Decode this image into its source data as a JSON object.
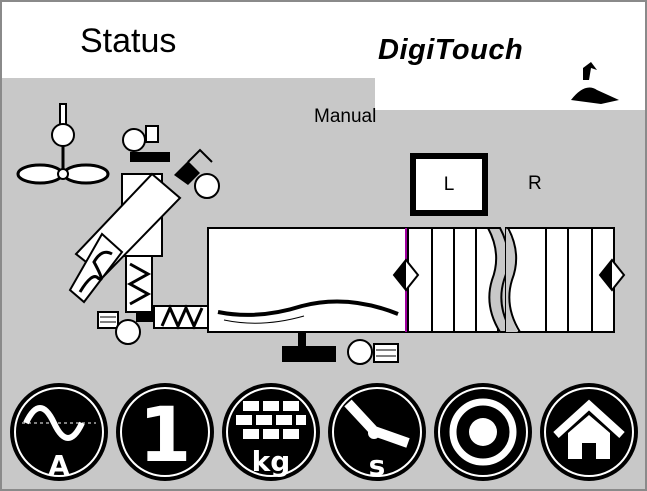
{
  "header": {
    "title": "Status",
    "logo_text": "DigiTouch"
  },
  "process": {
    "mode": "Manual",
    "side_selected": "L",
    "side_other": "R"
  },
  "buttons": [
    {
      "name": "analysis",
      "icon": "sine-wave-a-icon",
      "label": "A"
    },
    {
      "name": "program",
      "icon": "number-one-icon",
      "label": "1"
    },
    {
      "name": "weight",
      "icon": "bricks-kg-icon",
      "label": "kg"
    },
    {
      "name": "time",
      "icon": "clock-s-icon",
      "label": "s"
    },
    {
      "name": "target",
      "icon": "target-icon",
      "label": ""
    },
    {
      "name": "home",
      "icon": "home-icon",
      "label": ""
    }
  ],
  "colors": {
    "background": "#c8c8c8",
    "header": "#ffffff",
    "ink": "#000000",
    "accent_line": "#a000a0"
  }
}
